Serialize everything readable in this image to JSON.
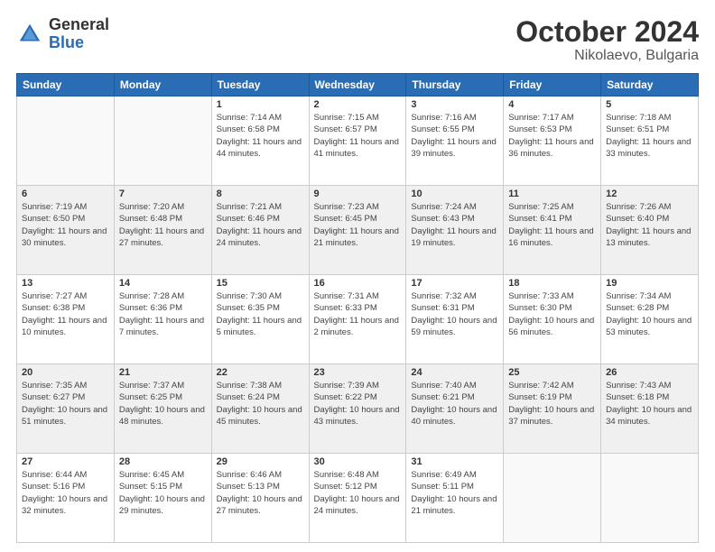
{
  "logo": {
    "general": "General",
    "blue": "Blue"
  },
  "title": {
    "month": "October 2024",
    "location": "Nikolaevo, Bulgaria"
  },
  "headers": [
    "Sunday",
    "Monday",
    "Tuesday",
    "Wednesday",
    "Thursday",
    "Friday",
    "Saturday"
  ],
  "weeks": [
    [
      {
        "day": "",
        "sunrise": "",
        "sunset": "",
        "daylight": ""
      },
      {
        "day": "",
        "sunrise": "",
        "sunset": "",
        "daylight": ""
      },
      {
        "day": "1",
        "sunrise": "Sunrise: 7:14 AM",
        "sunset": "Sunset: 6:58 PM",
        "daylight": "Daylight: 11 hours and 44 minutes."
      },
      {
        "day": "2",
        "sunrise": "Sunrise: 7:15 AM",
        "sunset": "Sunset: 6:57 PM",
        "daylight": "Daylight: 11 hours and 41 minutes."
      },
      {
        "day": "3",
        "sunrise": "Sunrise: 7:16 AM",
        "sunset": "Sunset: 6:55 PM",
        "daylight": "Daylight: 11 hours and 39 minutes."
      },
      {
        "day": "4",
        "sunrise": "Sunrise: 7:17 AM",
        "sunset": "Sunset: 6:53 PM",
        "daylight": "Daylight: 11 hours and 36 minutes."
      },
      {
        "day": "5",
        "sunrise": "Sunrise: 7:18 AM",
        "sunset": "Sunset: 6:51 PM",
        "daylight": "Daylight: 11 hours and 33 minutes."
      }
    ],
    [
      {
        "day": "6",
        "sunrise": "Sunrise: 7:19 AM",
        "sunset": "Sunset: 6:50 PM",
        "daylight": "Daylight: 11 hours and 30 minutes."
      },
      {
        "day": "7",
        "sunrise": "Sunrise: 7:20 AM",
        "sunset": "Sunset: 6:48 PM",
        "daylight": "Daylight: 11 hours and 27 minutes."
      },
      {
        "day": "8",
        "sunrise": "Sunrise: 7:21 AM",
        "sunset": "Sunset: 6:46 PM",
        "daylight": "Daylight: 11 hours and 24 minutes."
      },
      {
        "day": "9",
        "sunrise": "Sunrise: 7:23 AM",
        "sunset": "Sunset: 6:45 PM",
        "daylight": "Daylight: 11 hours and 21 minutes."
      },
      {
        "day": "10",
        "sunrise": "Sunrise: 7:24 AM",
        "sunset": "Sunset: 6:43 PM",
        "daylight": "Daylight: 11 hours and 19 minutes."
      },
      {
        "day": "11",
        "sunrise": "Sunrise: 7:25 AM",
        "sunset": "Sunset: 6:41 PM",
        "daylight": "Daylight: 11 hours and 16 minutes."
      },
      {
        "day": "12",
        "sunrise": "Sunrise: 7:26 AM",
        "sunset": "Sunset: 6:40 PM",
        "daylight": "Daylight: 11 hours and 13 minutes."
      }
    ],
    [
      {
        "day": "13",
        "sunrise": "Sunrise: 7:27 AM",
        "sunset": "Sunset: 6:38 PM",
        "daylight": "Daylight: 11 hours and 10 minutes."
      },
      {
        "day": "14",
        "sunrise": "Sunrise: 7:28 AM",
        "sunset": "Sunset: 6:36 PM",
        "daylight": "Daylight: 11 hours and 7 minutes."
      },
      {
        "day": "15",
        "sunrise": "Sunrise: 7:30 AM",
        "sunset": "Sunset: 6:35 PM",
        "daylight": "Daylight: 11 hours and 5 minutes."
      },
      {
        "day": "16",
        "sunrise": "Sunrise: 7:31 AM",
        "sunset": "Sunset: 6:33 PM",
        "daylight": "Daylight: 11 hours and 2 minutes."
      },
      {
        "day": "17",
        "sunrise": "Sunrise: 7:32 AM",
        "sunset": "Sunset: 6:31 PM",
        "daylight": "Daylight: 10 hours and 59 minutes."
      },
      {
        "day": "18",
        "sunrise": "Sunrise: 7:33 AM",
        "sunset": "Sunset: 6:30 PM",
        "daylight": "Daylight: 10 hours and 56 minutes."
      },
      {
        "day": "19",
        "sunrise": "Sunrise: 7:34 AM",
        "sunset": "Sunset: 6:28 PM",
        "daylight": "Daylight: 10 hours and 53 minutes."
      }
    ],
    [
      {
        "day": "20",
        "sunrise": "Sunrise: 7:35 AM",
        "sunset": "Sunset: 6:27 PM",
        "daylight": "Daylight: 10 hours and 51 minutes."
      },
      {
        "day": "21",
        "sunrise": "Sunrise: 7:37 AM",
        "sunset": "Sunset: 6:25 PM",
        "daylight": "Daylight: 10 hours and 48 minutes."
      },
      {
        "day": "22",
        "sunrise": "Sunrise: 7:38 AM",
        "sunset": "Sunset: 6:24 PM",
        "daylight": "Daylight: 10 hours and 45 minutes."
      },
      {
        "day": "23",
        "sunrise": "Sunrise: 7:39 AM",
        "sunset": "Sunset: 6:22 PM",
        "daylight": "Daylight: 10 hours and 43 minutes."
      },
      {
        "day": "24",
        "sunrise": "Sunrise: 7:40 AM",
        "sunset": "Sunset: 6:21 PM",
        "daylight": "Daylight: 10 hours and 40 minutes."
      },
      {
        "day": "25",
        "sunrise": "Sunrise: 7:42 AM",
        "sunset": "Sunset: 6:19 PM",
        "daylight": "Daylight: 10 hours and 37 minutes."
      },
      {
        "day": "26",
        "sunrise": "Sunrise: 7:43 AM",
        "sunset": "Sunset: 6:18 PM",
        "daylight": "Daylight: 10 hours and 34 minutes."
      }
    ],
    [
      {
        "day": "27",
        "sunrise": "Sunrise: 6:44 AM",
        "sunset": "Sunset: 5:16 PM",
        "daylight": "Daylight: 10 hours and 32 minutes."
      },
      {
        "day": "28",
        "sunrise": "Sunrise: 6:45 AM",
        "sunset": "Sunset: 5:15 PM",
        "daylight": "Daylight: 10 hours and 29 minutes."
      },
      {
        "day": "29",
        "sunrise": "Sunrise: 6:46 AM",
        "sunset": "Sunset: 5:13 PM",
        "daylight": "Daylight: 10 hours and 27 minutes."
      },
      {
        "day": "30",
        "sunrise": "Sunrise: 6:48 AM",
        "sunset": "Sunset: 5:12 PM",
        "daylight": "Daylight: 10 hours and 24 minutes."
      },
      {
        "day": "31",
        "sunrise": "Sunrise: 6:49 AM",
        "sunset": "Sunset: 5:11 PM",
        "daylight": "Daylight: 10 hours and 21 minutes."
      },
      {
        "day": "",
        "sunrise": "",
        "sunset": "",
        "daylight": ""
      },
      {
        "day": "",
        "sunrise": "",
        "sunset": "",
        "daylight": ""
      }
    ]
  ]
}
